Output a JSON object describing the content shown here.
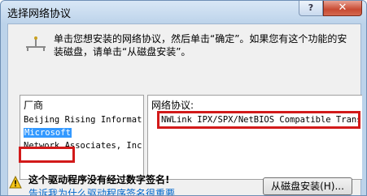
{
  "window": {
    "title": "选择网络协议",
    "help_label": "?",
    "close_label": "✕"
  },
  "instructions": "单击您想安装的网络协议，然后单击“确定”。如果您有这个功能的安装磁盘，请单击“从磁盘安装”。",
  "manufacturer_panel": {
    "header": "厂商",
    "items": [
      {
        "label": "Beijing Rising Informat"
      },
      {
        "label": "Microsoft",
        "selected": true
      },
      {
        "label": "Network Associates, Inc"
      }
    ]
  },
  "protocol_panel": {
    "header": "网络协议:",
    "items": [
      {
        "label": "NWLink IPX/SPX/NetBIOS Compatible Trans"
      }
    ]
  },
  "warning": {
    "text": "这个驱动程序没有经过数字签名!",
    "link": "告诉我为什么驱动程序签名很重要"
  },
  "buttons": {
    "have_disk": "从磁盘安装(H)..."
  },
  "colors": {
    "highlight_box": "#d21a1a",
    "selection": "#3399ff",
    "link": "#0066cc"
  },
  "icons": {
    "network": "network-protocol-icon",
    "warning": "warning-shield-icon"
  }
}
